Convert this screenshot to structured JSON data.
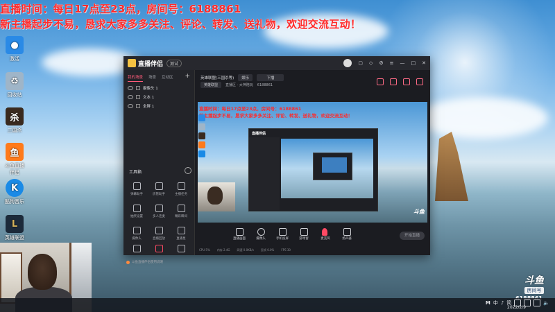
{
  "banner": {
    "line1": "直播时间：每日17点至23点，房间号：6188861",
    "line2": "新主播起步不易，恳求大家多多关注、评论、转发、送礼物，欢迎交流互动！"
  },
  "desktop_icons": [
    {
      "label": "激活",
      "icon": "app-icon",
      "color": "#2a8ae6"
    },
    {
      "label": "回收站",
      "icon": "recycle-bin-icon",
      "color": "#9fb5c8"
    },
    {
      "label": "三国杀",
      "icon": "game-icon",
      "color": "#3a2a1f"
    },
    {
      "label": "斗鱼直播伴侣",
      "icon": "douyu-icon",
      "color": "#ff7a1a"
    },
    {
      "label": "酷狗音乐",
      "icon": "kugou-icon",
      "color": "#1a8ae6"
    },
    {
      "label": "英雄联盟",
      "icon": "lol-icon",
      "color": "#1c2a3a"
    }
  ],
  "app": {
    "name": "直播伴侣",
    "version": "测试",
    "left_tabs": [
      "我的场景",
      "场景",
      "互动区"
    ],
    "sources": [
      "摄像头 1",
      "文本 1",
      "全屏 1"
    ],
    "tools_title": "工具箱",
    "tools": [
      "弹幕助手",
      "房管助手",
      "主播任务",
      "抽奖设置",
      "多人连麦",
      "精彩瞬间",
      "摄像头",
      "直播回放",
      "直播星"
    ],
    "bottom_tip": "斗鱼直播伴侣使用说明",
    "room_title": "英雄联盟(三国杀等)",
    "room_tag": "娱乐",
    "room_action": "下播",
    "room_category": "英雄联盟",
    "room_info": "直播区 · 大神陪玩",
    "room_id": "6188861",
    "controls": [
      "直播画面",
      "摄像头",
      "手机投屏",
      "游戏窗",
      "麦克风",
      "扬声器"
    ],
    "start_label": "开始直播",
    "status": [
      "CPU 5%",
      "内存 2.4G",
      "网速 0.0KB/s",
      "丢帧 0.0%",
      "FPS 30"
    ]
  },
  "preview": {
    "line1": "直播时间：每日17点至23点，房间号：6188861",
    "line2": "新主播起步不易，恳求大家多多关注、评论、转发、送礼物，欢迎交流互动！",
    "watermark": "斗鱼"
  },
  "overlay": {
    "brand": "斗鱼",
    "room_label": "房间号",
    "room_number": "6188861"
  },
  "taskbar": {
    "ime": "中",
    "lang": "简",
    "time": "2022/2/9"
  }
}
